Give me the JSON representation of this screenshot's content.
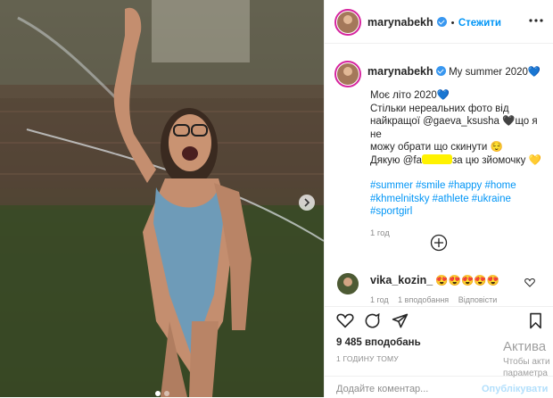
{
  "header": {
    "username": "marynabekh",
    "follow_label": "Стежити",
    "more_icon": "more-dots-icon"
  },
  "caption": {
    "username": "marynabekh",
    "inline_text": "My summer 2020💙",
    "lines": [
      "Моє літо 2020💙",
      "Стільки нереальних фото від",
      "найкращої @gaeva_ksusha 🖤що я не",
      "можу обрати що скинути 😌",
      "Дякую @fa",
      "за цю зйомочку 💛"
    ],
    "hashtags_lines": [
      "#summer #smile #happy #home",
      "#khmelnitsky #athlete #ukraine",
      "#sportgirl"
    ],
    "time": "1 год"
  },
  "load_more_icon": "plus-circle-icon",
  "comment": {
    "username": "vika_kozin_",
    "text": "😍😍😍😍😍",
    "time": "1 год",
    "likes": "1 вподобання",
    "reply": "Відповісти"
  },
  "stats": {
    "likes": "9 485 вподобань",
    "posted": "1 ГОДИНУ ТОМУ"
  },
  "add_comment": {
    "placeholder": "Додайте коментар...",
    "post_label": "Опублікувати"
  },
  "watermark": {
    "line1": "Актива",
    "line2": "Чтобы акти",
    "line3": "параметра"
  },
  "colors": {
    "accent": "#0095f6",
    "text": "#262626",
    "muted": "#8e8e8e",
    "highlight": "#fff200"
  }
}
